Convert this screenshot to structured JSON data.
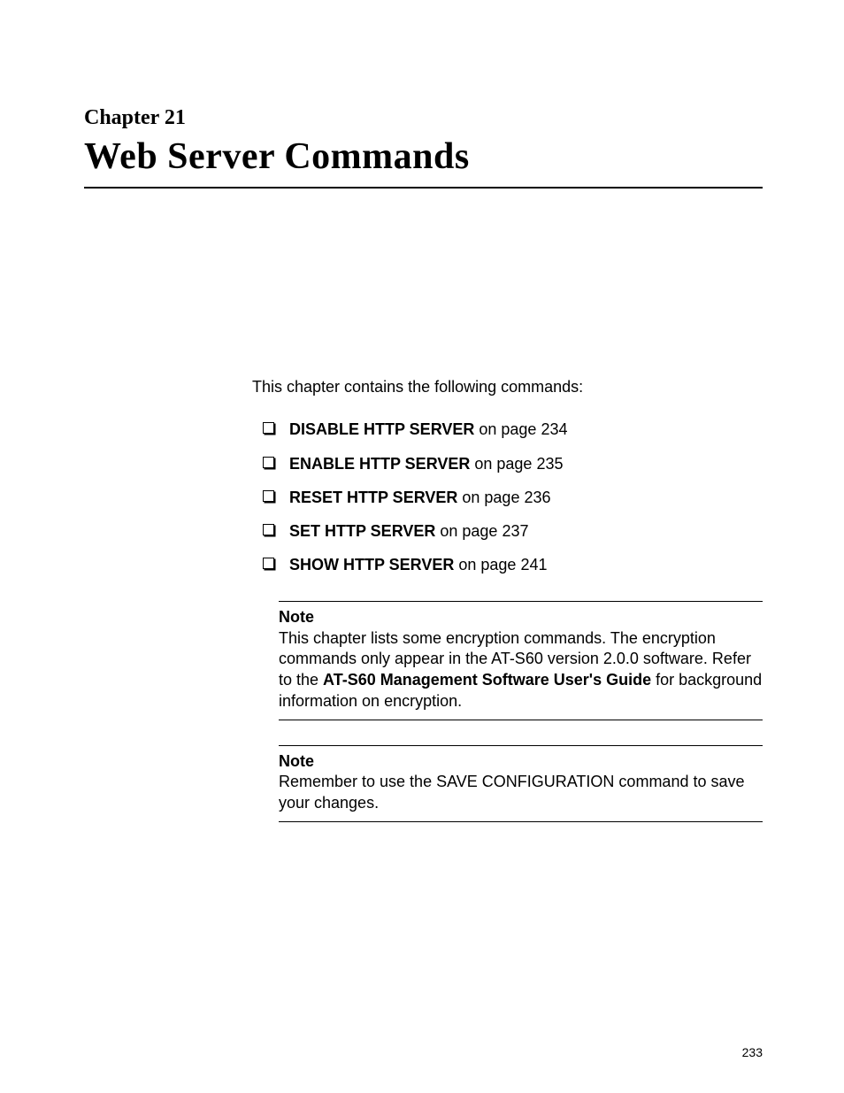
{
  "chapter": {
    "label": "Chapter 21",
    "title": "Web Server Commands"
  },
  "intro": "This chapter contains the following commands:",
  "commands": [
    {
      "name": "DISABLE HTTP SERVER",
      "suffix": " on page 234"
    },
    {
      "name": "ENABLE HTTP SERVER",
      "suffix": " on page 235"
    },
    {
      "name": "RESET HTTP SERVER",
      "suffix": " on page 236"
    },
    {
      "name": "SET HTTP SERVER",
      "suffix": " on page 237"
    },
    {
      "name": "SHOW HTTP SERVER",
      "suffix": " on page 241"
    }
  ],
  "notes": [
    {
      "label": "Note",
      "pre": "This chapter lists some encryption commands. The encryption commands only appear in the AT-S60 version 2.0.0 software. Refer to the ",
      "bold": "AT-S60 Management Software User's Guide",
      "post": " for background information on encryption."
    },
    {
      "label": "Note",
      "pre": "Remember to use the SAVE CONFIGURATION command to save your changes.",
      "bold": "",
      "post": ""
    }
  ],
  "page_number": "233"
}
